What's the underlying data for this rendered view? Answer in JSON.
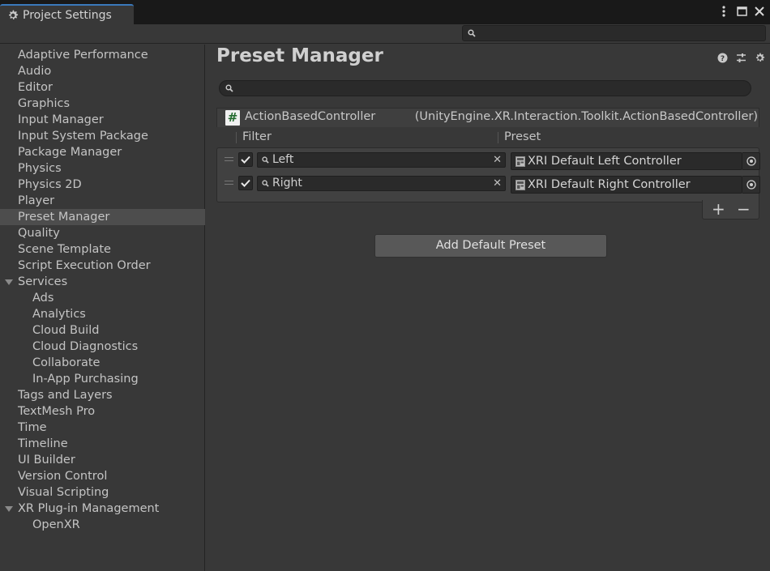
{
  "window": {
    "tab_title": "Project Settings",
    "icons": [
      "gear-icon",
      "kebab-menu-icon",
      "maximize-icon",
      "close-icon"
    ]
  },
  "toolbar": {
    "search_placeholder": ""
  },
  "sidebar": {
    "items": [
      {
        "label": "Adaptive Performance"
      },
      {
        "label": "Audio"
      },
      {
        "label": "Editor"
      },
      {
        "label": "Graphics"
      },
      {
        "label": "Input Manager"
      },
      {
        "label": "Input System Package"
      },
      {
        "label": "Package Manager"
      },
      {
        "label": "Physics"
      },
      {
        "label": "Physics 2D"
      },
      {
        "label": "Player"
      },
      {
        "label": "Preset Manager",
        "selected": true
      },
      {
        "label": "Quality"
      },
      {
        "label": "Scene Template"
      },
      {
        "label": "Script Execution Order"
      },
      {
        "label": "Services",
        "expanded": true
      },
      {
        "label": "Ads",
        "child": true
      },
      {
        "label": "Analytics",
        "child": true
      },
      {
        "label": "Cloud Build",
        "child": true
      },
      {
        "label": "Cloud Diagnostics",
        "child": true
      },
      {
        "label": "Collaborate",
        "child": true
      },
      {
        "label": "In-App Purchasing",
        "child": true
      },
      {
        "label": "Tags and Layers"
      },
      {
        "label": "TextMesh Pro"
      },
      {
        "label": "Time"
      },
      {
        "label": "Timeline"
      },
      {
        "label": "UI Builder"
      },
      {
        "label": "Version Control"
      },
      {
        "label": "Visual Scripting"
      },
      {
        "label": "XR Plug-in Management",
        "expanded": true
      },
      {
        "label": "OpenXR",
        "child": true
      }
    ]
  },
  "main": {
    "title": "Preset Manager",
    "header_icons": [
      "help-icon",
      "preset-settings-icon",
      "gear-icon"
    ],
    "search_placeholder": "",
    "component": {
      "name": "ActionBasedController",
      "type": "(UnityEngine.XR.Interaction.Toolkit.ActionBasedController)",
      "icon_glyph": "#"
    },
    "columns": {
      "filter": "Filter",
      "preset": "Preset"
    },
    "rows": [
      {
        "enabled": true,
        "filter": "Left",
        "preset": "XRI Default Left Controller"
      },
      {
        "enabled": true,
        "filter": "Right",
        "preset": "XRI Default Right Controller"
      }
    ],
    "list_buttons": {
      "add": "+",
      "remove": "−"
    },
    "add_default_button": "Add Default Preset"
  },
  "colors": {
    "background": "#383838",
    "titlebar": "#191919",
    "selected_item": "#4d4d4d",
    "tab_accent": "#3a79bb",
    "field": "#2a2a2a",
    "script_icon_green": "#246b2f"
  }
}
